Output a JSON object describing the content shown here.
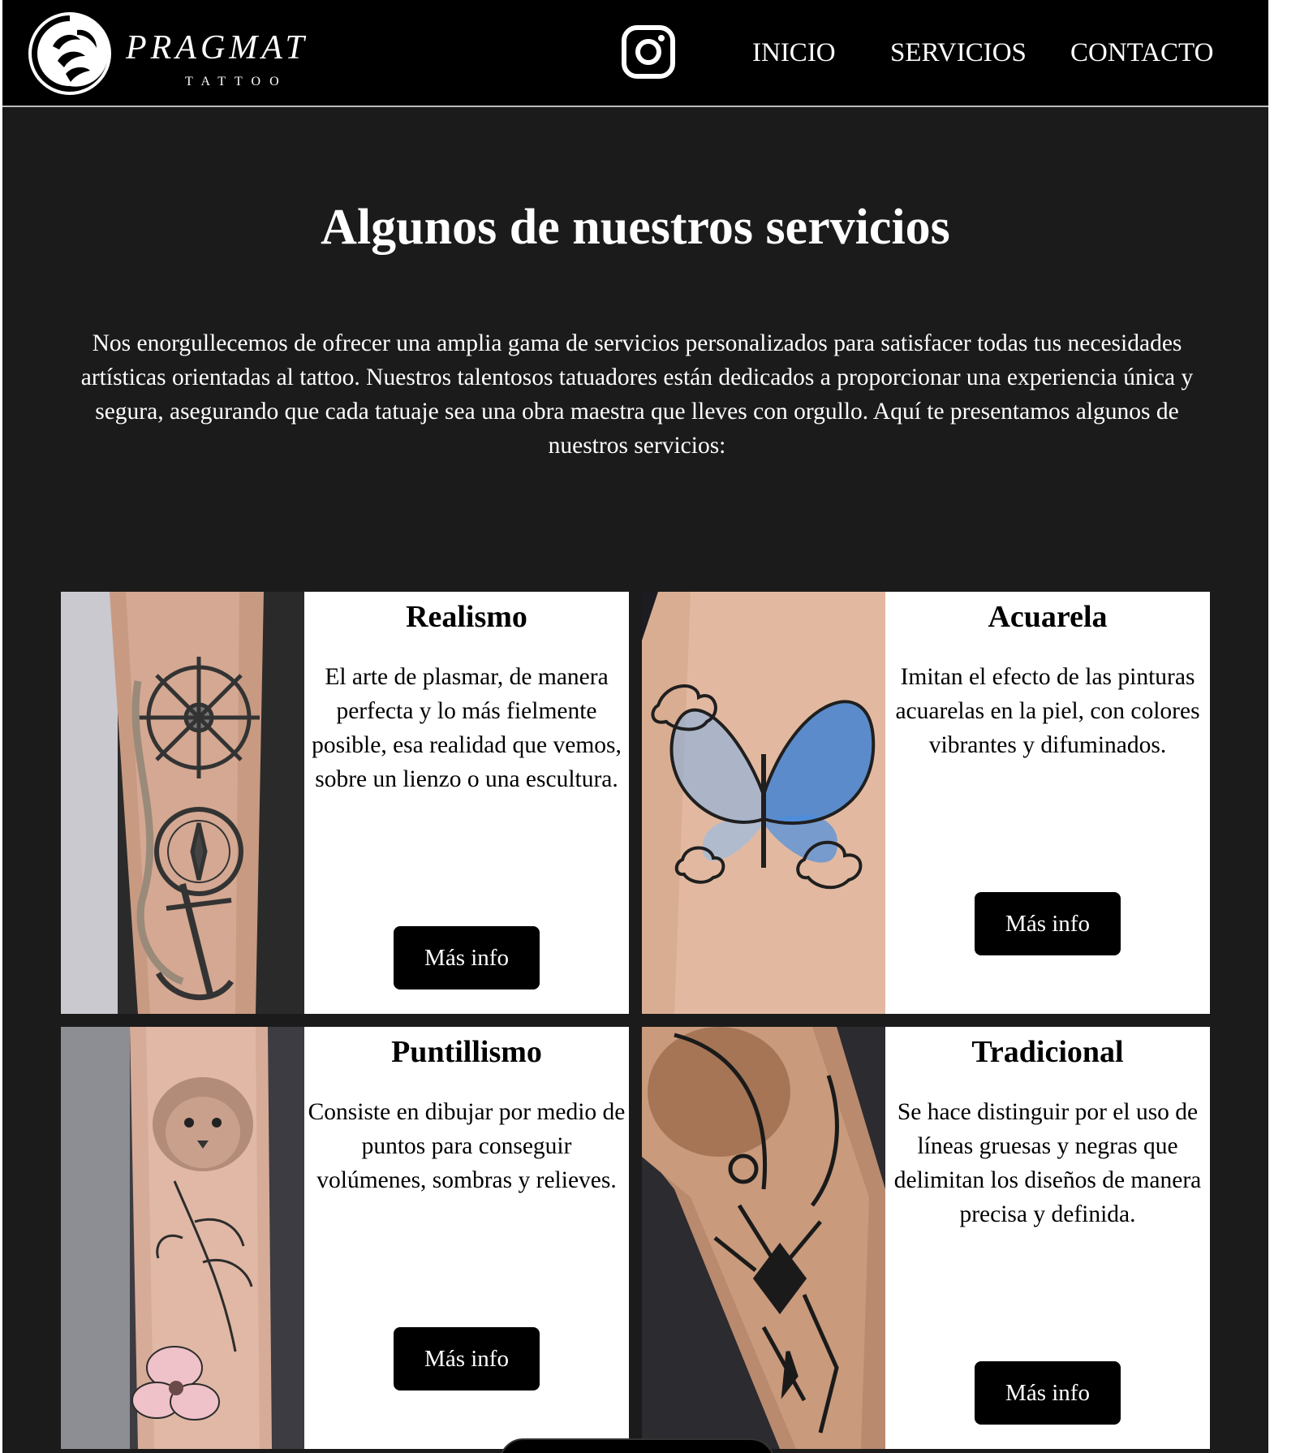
{
  "header": {
    "brand_name": "PRAGMAT",
    "brand_sub": "TATTOO",
    "nav": {
      "inicio": "INICIO",
      "servicios": "SERVICIOS",
      "contacto": "CONTACTO"
    }
  },
  "main": {
    "title": "Algunos de nuestros servicios",
    "intro": "Nos enorgullecemos de ofrecer una amplia gama de servicios personalizados para satisfacer todas tus necesidades artísticas orientadas al tattoo. Nuestros talentosos tatuadores están dedicados a proporcionar una experiencia única y segura, asegurando que cada tatuaje sea una obra maestra que lleves con orgullo. Aquí te presentamos algunos de nuestros servicios:"
  },
  "services": [
    {
      "title": "Realismo",
      "text": "El arte de plasmar, de manera perfecta y lo más fielmente posible, esa realidad que vemos, sobre un lienzo o una escultura.",
      "button": "Más info",
      "image": "ship-wheel-compass-anchor-tattoo"
    },
    {
      "title": "Acuarela",
      "text": "Imitan el efecto de las pinturas acuarelas en la piel, con colores vibrantes y difuminados.",
      "button": "Más info",
      "image": "blue-watercolor-butterfly-tattoo"
    },
    {
      "title": "Puntillismo",
      "text": "Consiste en dibujar por medio de puntos para conseguir volúmenes, sombras y relieves.",
      "button": "Más info",
      "image": "lion-cub-flower-tattoo"
    },
    {
      "title": "Tradicional",
      "text": "Se hace distinguir por el uso de líneas gruesas y negras que delimitan los diseños de manera precisa y definida.",
      "button": "Más info",
      "image": "geometric-line-arm-tattoo"
    }
  ],
  "colors": {
    "page_bg": "#1b1b1b",
    "header_bg": "#000000",
    "card_bg": "#ffffff",
    "button_bg": "#000000",
    "text_light": "#ffffff",
    "watercolor_blue": "#3a7fd6"
  },
  "icons": {
    "logo": "leaf-circle-logo-icon",
    "instagram": "instagram-icon"
  }
}
